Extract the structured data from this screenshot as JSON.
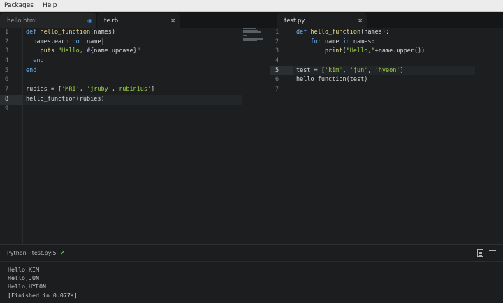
{
  "menu": {
    "items": [
      "Packages",
      "Help"
    ]
  },
  "left_pane": {
    "tabs": [
      {
        "label": "hello.html",
        "indicator": "modified-dot-icon",
        "active": false
      },
      {
        "label": "te.rb",
        "indicator": "close-icon",
        "active": true
      }
    ],
    "line_numbers": [
      "1",
      "2",
      "3",
      "4",
      "5",
      "6",
      "7",
      "8",
      "9"
    ],
    "current_line": "8",
    "code": [
      [
        {
          "t": "def ",
          "c": "kw"
        },
        {
          "t": "hello_function",
          "c": "fn"
        },
        {
          "t": "(names)",
          "c": ""
        }
      ],
      [
        {
          "t": "  names.each ",
          "c": ""
        },
        {
          "t": "do",
          "c": "kw"
        },
        {
          "t": " |name|",
          "c": ""
        }
      ],
      [
        {
          "t": "    puts ",
          "c": "fn"
        },
        {
          "t": "\"Hello, ",
          "c": "str"
        },
        {
          "t": "#{",
          "c": "var"
        },
        {
          "t": "name.upcase",
          "c": ""
        },
        {
          "t": "}",
          "c": "var"
        },
        {
          "t": "\"",
          "c": "str"
        }
      ],
      [
        {
          "t": "  end",
          "c": "kw"
        }
      ],
      [
        {
          "t": "end",
          "c": "kw"
        }
      ],
      [
        {
          "t": "",
          "c": ""
        }
      ],
      [
        {
          "t": "rubies = [",
          "c": ""
        },
        {
          "t": "'MRI'",
          "c": "str"
        },
        {
          "t": ", ",
          "c": ""
        },
        {
          "t": "'jruby'",
          "c": "str"
        },
        {
          "t": ",",
          "c": ""
        },
        {
          "t": "'rubinius'",
          "c": "str"
        },
        {
          "t": "]",
          "c": ""
        }
      ],
      [
        {
          "t": "hello_function(rubies)",
          "c": ""
        }
      ],
      [
        {
          "t": "",
          "c": ""
        }
      ]
    ]
  },
  "right_pane": {
    "tabs": [
      {
        "label": "test.py",
        "indicator": "close-icon",
        "active": true
      }
    ],
    "line_numbers": [
      "1",
      "2",
      "3",
      "4",
      "5",
      "6",
      "7"
    ],
    "current_line": "5",
    "code": [
      [
        {
          "t": "def ",
          "c": "kw"
        },
        {
          "t": "hello_function",
          "c": "fn"
        },
        {
          "t": "(names):",
          "c": ""
        }
      ],
      [
        {
          "t": "    ",
          "c": ""
        },
        {
          "t": "for",
          "c": "kw"
        },
        {
          "t": " name ",
          "c": ""
        },
        {
          "t": "in",
          "c": "kw"
        },
        {
          "t": " names:",
          "c": ""
        }
      ],
      [
        {
          "t": "        ",
          "c": ""
        },
        {
          "t": "print",
          "c": "fn"
        },
        {
          "t": "(",
          "c": ""
        },
        {
          "t": "\"Hello,\"",
          "c": "str"
        },
        {
          "t": "+name.upper())",
          "c": ""
        }
      ],
      [
        {
          "t": "",
          "c": ""
        }
      ],
      [
        {
          "t": "test = [",
          "c": ""
        },
        {
          "t": "'kim'",
          "c": "str"
        },
        {
          "t": ", ",
          "c": ""
        },
        {
          "t": "'jun'",
          "c": "str"
        },
        {
          "t": ", ",
          "c": ""
        },
        {
          "t": "'hyeon'",
          "c": "str"
        },
        {
          "t": "]",
          "c": ""
        }
      ],
      [
        {
          "t": "hello_function(test)",
          "c": ""
        }
      ],
      [
        {
          "t": "",
          "c": ""
        }
      ]
    ]
  },
  "output_panel": {
    "title": "Python - test.py:5",
    "status_icon": "check-icon",
    "lines": [
      "Hello,KIM",
      "Hello,JUN",
      "Hello,HYEON",
      "[Finished in 0.077s]"
    ]
  },
  "colors": {
    "keyword": "#6eb1e8",
    "function": "#e7d98b",
    "string": "#9ccd4e",
    "interp": "#d0b4f0",
    "success": "#5fc15f",
    "modified": "#3c8ee5"
  }
}
